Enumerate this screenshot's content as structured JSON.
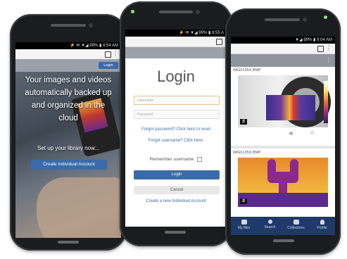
{
  "phone1": {
    "status": "⚡ ✉ ▼◢ 99% ▮ 8:54 AM",
    "login_label": "Login",
    "hero_lines": [
      "Your images and videos",
      "automatically backed up",
      "and organized in the",
      "cloud"
    ],
    "setup_text": "Set up your library now...",
    "create_button": "Create Individual Account"
  },
  "phone2": {
    "status": "⚡ ✉ ▼◢ 99% ▮ 8:55 A",
    "title": "Login",
    "username_placeholder": "Username",
    "password_placeholder": "Password",
    "forgot_password": "Forgot password? Click here to reset",
    "forgot_username": "Forgot username? Click here.",
    "remember_label": "Remember username",
    "login_button": "Login",
    "cancel_button": "Cancel",
    "create_link": "Create a new Individual Account"
  },
  "phone3": {
    "status": "▼◢ 99% ▮ 9:04 AM",
    "card1_label": "IMG0135X.BMP",
    "card2_label": "IMG0135X.BMP",
    "badge": "S",
    "tabs": [
      {
        "label": "My files",
        "icon": "folder-icon"
      },
      {
        "label": "Search",
        "icon": "search-icon"
      },
      {
        "label": "Collections",
        "icon": "collections-icon"
      },
      {
        "label": "Profile",
        "icon": "profile-icon"
      }
    ]
  },
  "colors": {
    "accent": "#3b6aa8",
    "tabbar": "#1f3a68"
  }
}
